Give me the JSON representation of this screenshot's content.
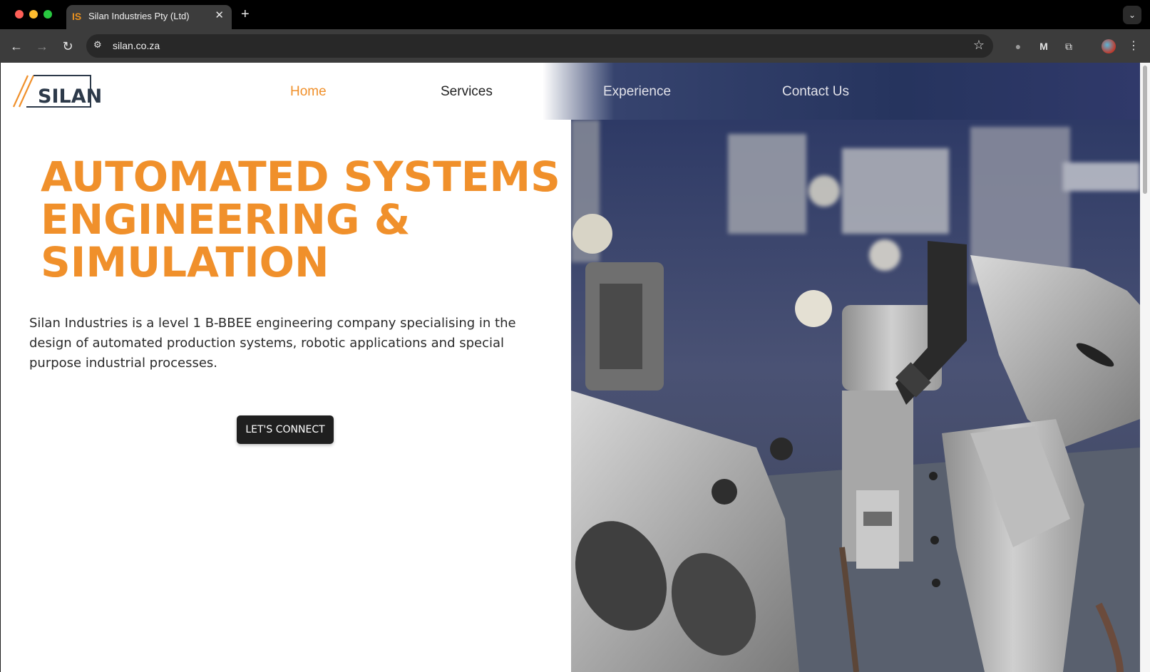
{
  "browser": {
    "tab_title": "Silan Industries Pty (Ltd)",
    "tab_favicon": "IS",
    "url": "silan.co.za"
  },
  "site": {
    "logo_text": "SILAN",
    "nav": {
      "home": "Home",
      "services": "Services",
      "experience": "Experience",
      "contact": "Contact Us"
    },
    "hero": {
      "headline_line1": "AUTOMATED SYSTEMS",
      "headline_line2": "ENGINEERING &",
      "headline_line3": "SIMULATION",
      "intro": "Silan Industries is a level 1 B-BBEE engineering company specialising in the design of automated production systems, robotic applications and special purpose industrial processes.",
      "cta_label": "LET'S CONNECT"
    }
  },
  "colors": {
    "accent": "#f0902b",
    "dark": "#1f1f1f"
  },
  "icons": [
    "back-icon",
    "forward-icon",
    "reload-icon",
    "site-info-icon",
    "bookmark-star-icon",
    "extension-icon",
    "menu-icon"
  ]
}
